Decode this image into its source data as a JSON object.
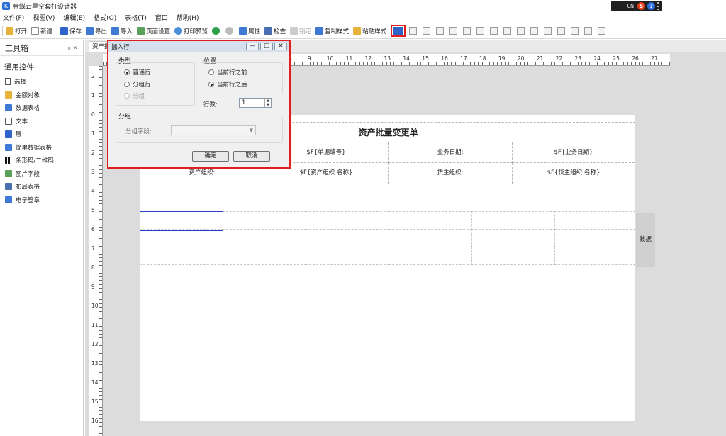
{
  "title": "金蝶云星空套打设计器",
  "system_tray": {
    "lang": "CN",
    "s_label": "S",
    "help_label": "?"
  },
  "menu": [
    "文件(F)",
    "视图(V)",
    "编辑(E)",
    "格式(O)",
    "表格(T)",
    "窗口",
    "帮助(H)"
  ],
  "toolbar": {
    "open": "打开",
    "new": "新建",
    "save": "保存",
    "export": "导出",
    "import": "导入",
    "page_setup": "页面设置",
    "print_preview": "打印预览",
    "properties": "属性",
    "check": "检查",
    "lock": "锁定",
    "copy_style": "复制样式",
    "paste_style": "粘贴样式"
  },
  "toolbox": {
    "title": "工具箱",
    "pin": "ᵩ",
    "close": "×",
    "group": "通用控件",
    "items": [
      "选择",
      "金额对象",
      "数据表格",
      "文本",
      "层",
      "简单数据表格",
      "条形码/二维码",
      "图片字段",
      "布局表格",
      "电子签章"
    ]
  },
  "document": {
    "tab": "资产批",
    "ruler_top": [
      "8",
      "9",
      "10",
      "11",
      "12",
      "13",
      "14",
      "15",
      "16",
      "17",
      "18",
      "19",
      "20",
      "21",
      "22",
      "23",
      "24",
      "25",
      "26",
      "27"
    ],
    "ruler_left": [
      "2",
      "1",
      "0",
      "1",
      "2",
      "3",
      "4",
      "5",
      "6",
      "7",
      "8",
      "9",
      "10",
      "11",
      "12",
      "13",
      "14",
      "15",
      "16"
    ],
    "report_title": "资产批量变更单",
    "row1": [
      "$F{单据编号}",
      "业务日期:",
      "$F{业务日期}"
    ],
    "row2": [
      "资产组织:",
      "$F{资产组织.名称}",
      "货主组织:",
      "$F{货主组织.名称}"
    ],
    "side_label": "数据"
  },
  "dialog": {
    "title": "插入行",
    "type_label": "类型",
    "type_options": [
      "普通行",
      "分组行",
      "分组"
    ],
    "position_label": "位置",
    "position_options": [
      "当前行之前",
      "当前行之后"
    ],
    "rows_label": "行数:",
    "rows_value": "1",
    "group_label": "分组",
    "group_field_label": "分组字段:",
    "ok": "确定",
    "cancel": "取消"
  }
}
